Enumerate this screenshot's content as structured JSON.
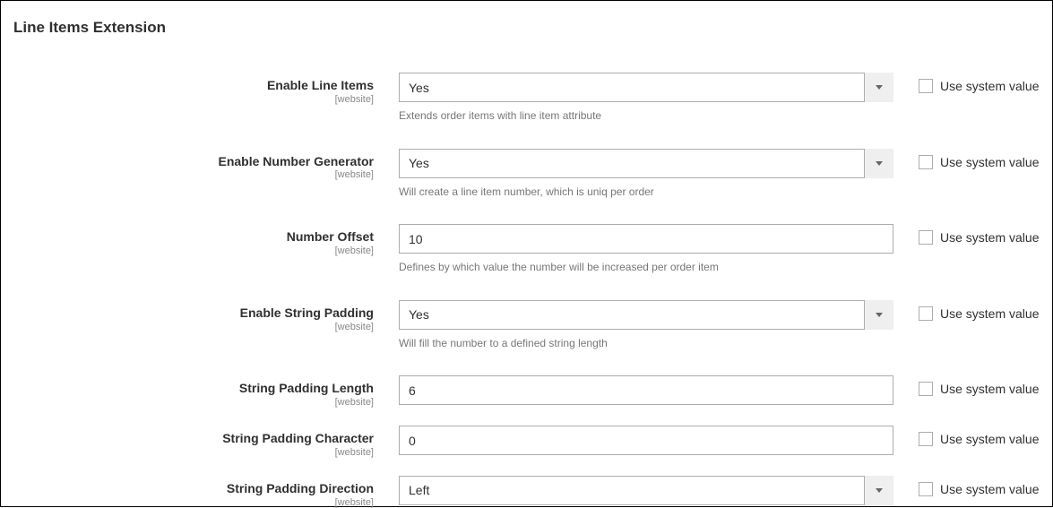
{
  "section_title": "Line Items Extension",
  "scope_label": "[website]",
  "use_system_value_label": "Use system value",
  "fields": {
    "enable_line_items": {
      "label": "Enable Line Items",
      "value": "Yes",
      "help": "Extends order items with line item attribute"
    },
    "enable_number_generator": {
      "label": "Enable Number Generator",
      "value": "Yes",
      "help": "Will create a line item number, which is uniq per order"
    },
    "number_offset": {
      "label": "Number Offset",
      "value": "10",
      "help": "Defines by which value the number will be increased per order item"
    },
    "enable_string_padding": {
      "label": "Enable String Padding",
      "value": "Yes",
      "help": "Will fill the number to a defined string length"
    },
    "string_padding_length": {
      "label": "String Padding Length",
      "value": "6"
    },
    "string_padding_character": {
      "label": "String Padding Character",
      "value": "0"
    },
    "string_padding_direction": {
      "label": "String Padding Direction",
      "value": "Left"
    }
  }
}
